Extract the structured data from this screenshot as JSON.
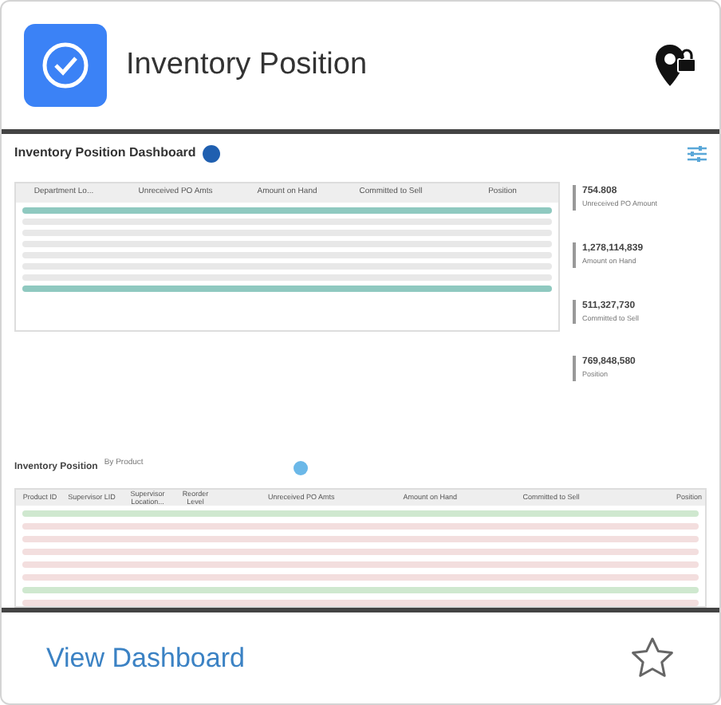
{
  "card": {
    "title": "Inventory Position",
    "link": "View Dashboard",
    "favorite": false
  },
  "preview": {
    "title": "Inventory Position Dashboard",
    "table": {
      "columns": [
        "Department Lo...",
        "Unreceived PO Amts",
        "Amount on Hand",
        "Committed to Sell",
        "Position"
      ]
    },
    "kpis": [
      {
        "value": "754.808",
        "label": "Unreceived PO Amount"
      },
      {
        "value": "1,278,114,839",
        "label": "Amount on Hand"
      },
      {
        "value": "511,327,730",
        "label": "Committed to Sell"
      },
      {
        "value": "769,848,580",
        "label": "Position"
      }
    ],
    "section": {
      "title": "Inventory Position",
      "subtitle": "By Product"
    },
    "table2": {
      "columns": [
        "Product ID",
        "Supervisor LID",
        "Supervisor Location...",
        "Reorder Level",
        "Unreceived PO Amts",
        "Amount on Hand",
        "Committed to Sell",
        "Position"
      ]
    }
  }
}
